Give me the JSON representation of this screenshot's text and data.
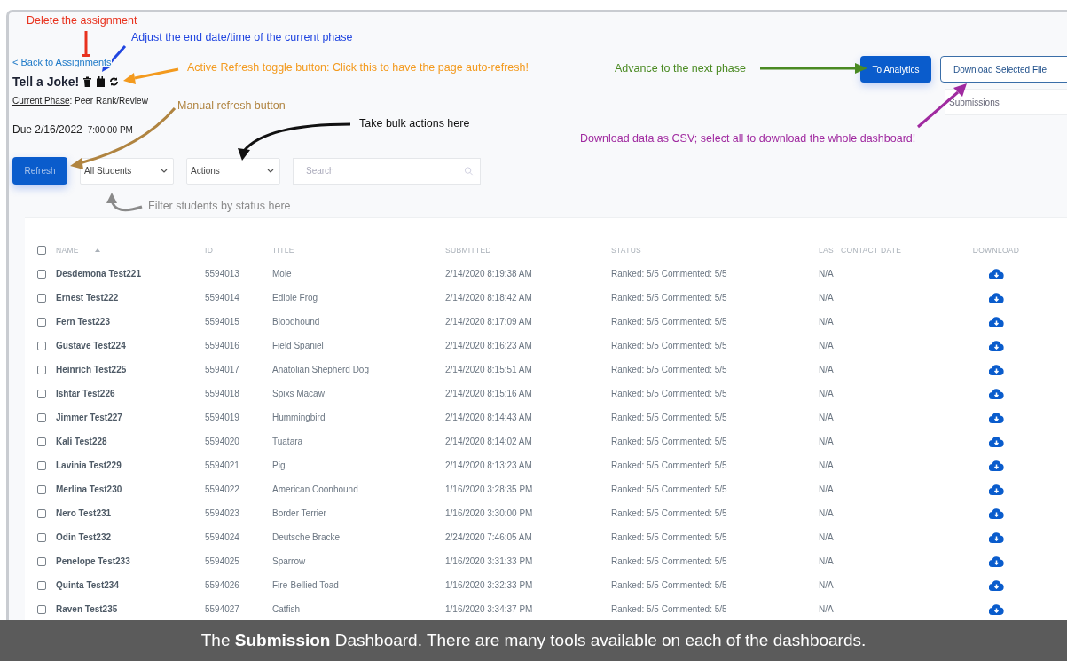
{
  "header": {
    "back_link": "< Back to Assignments",
    "title": "Tell a Joke!",
    "phase_label": "Current Phase",
    "phase_value": ": Peer Rank/Review",
    "due_date": "Due 2/16/2022",
    "due_time": "7:00:00 PM",
    "auto_refresh_on": true
  },
  "actions": {
    "analytics_button": "To Analytics",
    "download_button": "Download Selected File",
    "view_select": "Submissions"
  },
  "toolbar": {
    "refresh_button": "Refresh",
    "filter_select": "All Students",
    "actions_select": "Actions",
    "search": {
      "placeholder": "Search"
    }
  },
  "table": {
    "all_checked": false,
    "columns": [
      {
        "label": "NAME",
        "sorted": true
      },
      {
        "label": "ID",
        "sorted": false
      },
      {
        "label": "TITLE",
        "sorted": false
      },
      {
        "label": "SUBMITTED",
        "sorted": false
      },
      {
        "label": "STATUS",
        "sorted": false
      },
      {
        "label": "LAST CONTACT DATE",
        "sorted": false
      },
      {
        "label": "DOWNLOAD",
        "sorted": false
      }
    ],
    "rows": [
      {
        "checked": false,
        "name": "Desdemona Test221",
        "id": "5594013",
        "title": "Mole",
        "submitted": "2/14/2020 8:19:38 AM",
        "status": "Ranked: 5/5 Commented: 5/5",
        "last_contact": "N/A"
      },
      {
        "checked": false,
        "name": "Ernest Test222",
        "id": "5594014",
        "title": "Edible Frog",
        "submitted": "2/14/2020 8:18:42 AM",
        "status": "Ranked: 5/5 Commented: 5/5",
        "last_contact": "N/A"
      },
      {
        "checked": false,
        "name": "Fern Test223",
        "id": "5594015",
        "title": "Bloodhound",
        "submitted": "2/14/2020 8:17:09 AM",
        "status": "Ranked: 5/5 Commented: 5/5",
        "last_contact": "N/A"
      },
      {
        "checked": false,
        "name": "Gustave Test224",
        "id": "5594016",
        "title": "Field Spaniel",
        "submitted": "2/14/2020 8:16:23 AM",
        "status": "Ranked: 5/5 Commented: 5/5",
        "last_contact": "N/A"
      },
      {
        "checked": false,
        "name": "Heinrich Test225",
        "id": "5594017",
        "title": "Anatolian Shepherd Dog",
        "submitted": "2/14/2020 8:15:51 AM",
        "status": "Ranked: 5/5 Commented: 5/5",
        "last_contact": "N/A"
      },
      {
        "checked": false,
        "name": "Ishtar Test226",
        "id": "5594018",
        "title": "Spixs Macaw",
        "submitted": "2/14/2020 8:15:16 AM",
        "status": "Ranked: 5/5 Commented: 5/5",
        "last_contact": "N/A"
      },
      {
        "checked": false,
        "name": "Jimmer Test227",
        "id": "5594019",
        "title": "Hummingbird",
        "submitted": "2/14/2020 8:14:43 AM",
        "status": "Ranked: 5/5 Commented: 5/5",
        "last_contact": "N/A"
      },
      {
        "checked": false,
        "name": "Kali Test228",
        "id": "5594020",
        "title": "Tuatara",
        "submitted": "2/14/2020 8:14:02 AM",
        "status": "Ranked: 5/5 Commented: 5/5",
        "last_contact": "N/A"
      },
      {
        "checked": false,
        "name": "Lavinia Test229",
        "id": "5594021",
        "title": "Pig",
        "submitted": "2/14/2020 8:13:23 AM",
        "status": "Ranked: 5/5 Commented: 5/5",
        "last_contact": "N/A"
      },
      {
        "checked": false,
        "name": "Merlina Test230",
        "id": "5594022",
        "title": "American Coonhound",
        "submitted": "1/16/2020 3:28:35 PM",
        "status": "Ranked: 5/5 Commented: 5/5",
        "last_contact": "N/A"
      },
      {
        "checked": false,
        "name": "Nero Test231",
        "id": "5594023",
        "title": "Border Terrier",
        "submitted": "1/16/2020 3:30:00 PM",
        "status": "Ranked: 5/5 Commented: 5/5",
        "last_contact": "N/A"
      },
      {
        "checked": false,
        "name": "Odin Test232",
        "id": "5594024",
        "title": "Deutsche Bracke",
        "submitted": "2/24/2020 7:46:05 AM",
        "status": "Ranked: 5/5 Commented: 5/5",
        "last_contact": "N/A"
      },
      {
        "checked": false,
        "name": "Penelope Test233",
        "id": "5594025",
        "title": "Sparrow",
        "submitted": "1/16/2020 3:31:33 PM",
        "status": "Ranked: 5/5 Commented: 5/5",
        "last_contact": "N/A"
      },
      {
        "checked": false,
        "name": "Quinta Test234",
        "id": "5594026",
        "title": "Fire-Bellied Toad",
        "submitted": "1/16/2020 3:32:33 PM",
        "status": "Ranked: 5/5 Commented: 5/5",
        "last_contact": "N/A"
      },
      {
        "checked": false,
        "name": "Raven Test235",
        "id": "5594027",
        "title": "Catfish",
        "submitted": "1/16/2020 3:34:37 PM",
        "status": "Ranked: 5/5 Commented: 5/5",
        "last_contact": "N/A"
      }
    ]
  },
  "annotations": [
    {
      "text": "Delete the assignment",
      "color": "#e8321e"
    },
    {
      "text": "Adjust the end date/time of the current phase",
      "color": "#2146e0"
    },
    {
      "text": "Active Refresh toggle button: Click this to have the page auto-refresh!",
      "color": "#f39a1e"
    },
    {
      "text": "Manual refresh button",
      "color": "#b08440"
    },
    {
      "text": "Take bulk actions here",
      "color": "#111111"
    },
    {
      "text": "Filter students by status here",
      "color": "#8a8a8a"
    },
    {
      "text": "Advance to the next phase",
      "color": "#4a8a22"
    },
    {
      "text": "Download data as CSV; select all to download the whole dashboard!",
      "color": "#a02aa0"
    }
  ],
  "caption": "The **Submission** Dashboard. There are many tools available on each of the dashboards."
}
